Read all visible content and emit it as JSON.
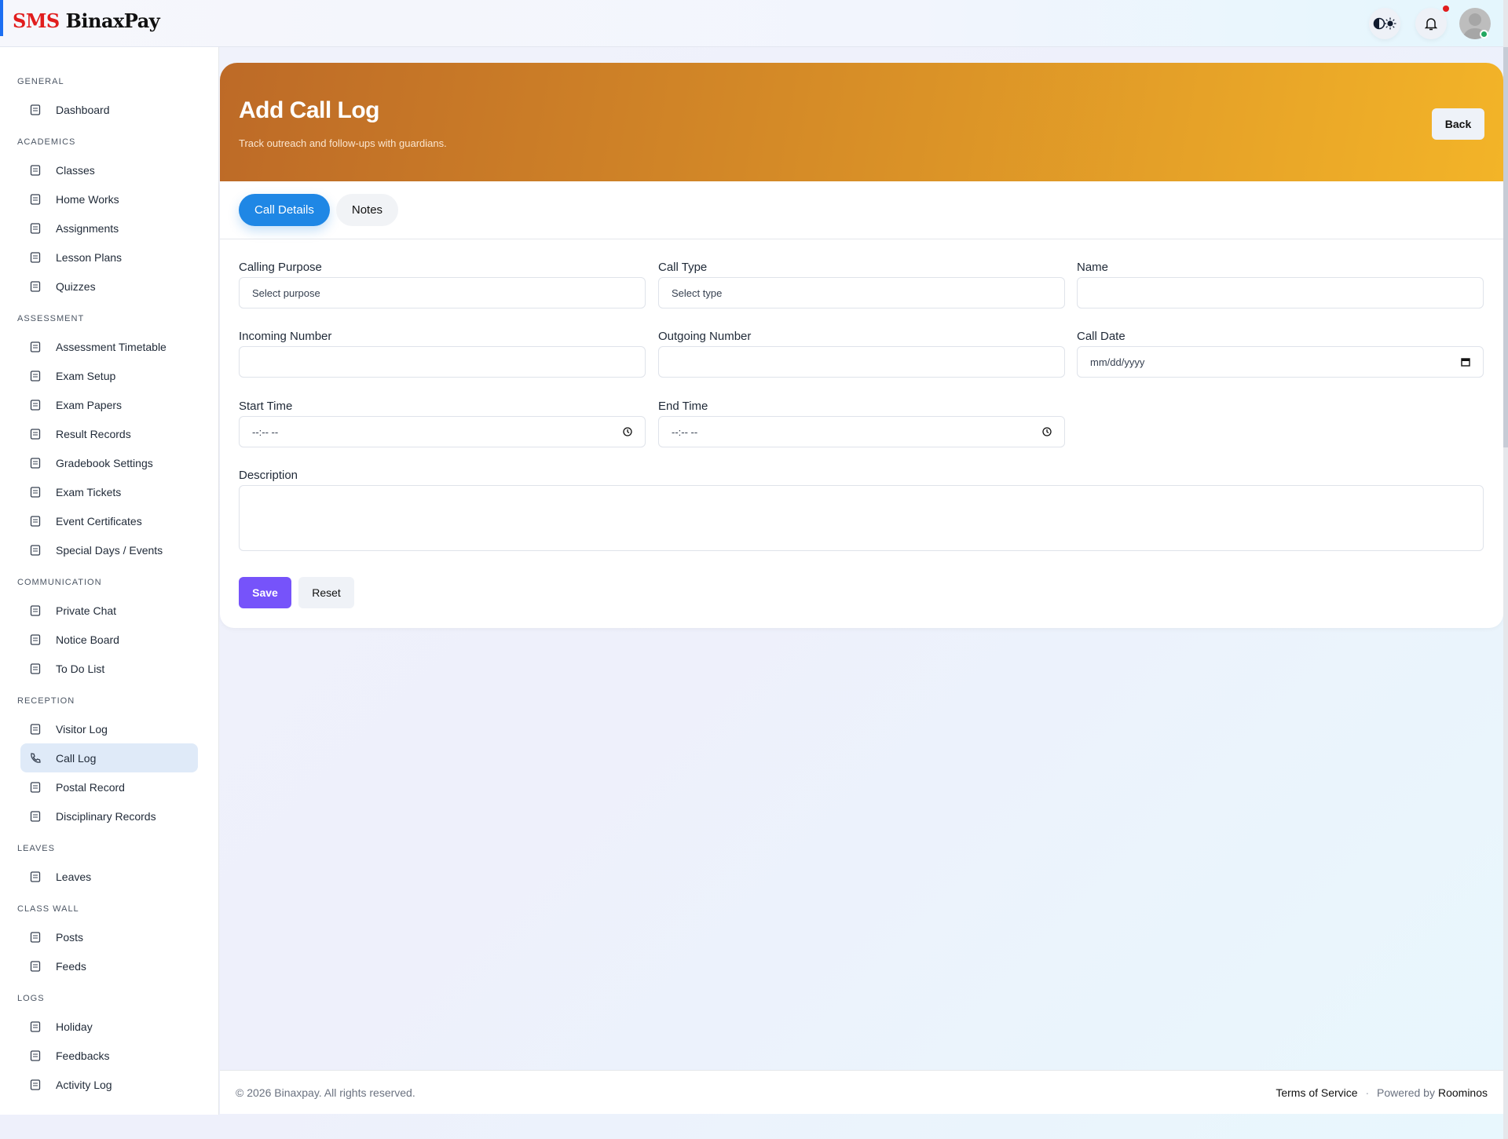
{
  "brand": {
    "sms": "SMS",
    "name": "BinaxPay"
  },
  "topbar": {
    "theme_icon": "contrast-sun-icon",
    "bell_icon": "bell-icon",
    "colors": {
      "notif": "#e11d1d",
      "online": "#22a861"
    }
  },
  "sidebar": {
    "sections": [
      {
        "title": "GENERAL",
        "items": [
          {
            "label": "Dashboard",
            "icon": "gauge-icon"
          }
        ]
      },
      {
        "title": "ACADEMICS",
        "items": [
          {
            "label": "Classes",
            "icon": "hierarchy-icon"
          },
          {
            "label": "Home Works",
            "icon": "notebook-icon"
          },
          {
            "label": "Assignments",
            "icon": "clipboard-check-icon"
          },
          {
            "label": "Lesson Plans",
            "icon": "book-icon"
          },
          {
            "label": "Quizzes",
            "icon": "award-icon"
          }
        ]
      },
      {
        "title": "ASSESSMENT",
        "items": [
          {
            "label": "Assessment Timetable",
            "icon": "table-icon"
          },
          {
            "label": "Exam Setup",
            "icon": "clipboard-plus-icon"
          },
          {
            "label": "Exam Papers",
            "icon": "grid-icon"
          },
          {
            "label": "Result Records",
            "icon": "check-square-icon"
          },
          {
            "label": "Gradebook Settings",
            "icon": "gear-icon"
          },
          {
            "label": "Exam Tickets",
            "icon": "ticket-icon"
          },
          {
            "label": "Event Certificates",
            "icon": "award-icon"
          },
          {
            "label": "Special Days / Events",
            "icon": "calendar-icon"
          }
        ]
      },
      {
        "title": "COMMUNICATION",
        "items": [
          {
            "label": "Private Chat",
            "icon": "chat-icon"
          },
          {
            "label": "Notice Board",
            "icon": "megaphone-icon"
          },
          {
            "label": "To Do List",
            "icon": "list-icon"
          }
        ]
      },
      {
        "title": "RECEPTION",
        "items": [
          {
            "label": "Visitor Log",
            "icon": "id-badge-icon"
          },
          {
            "label": "Call Log",
            "icon": "phone-icon",
            "active": true
          },
          {
            "label": "Postal Record",
            "icon": "mailbox-icon"
          },
          {
            "label": "Disciplinary Records",
            "icon": "warning-icon"
          }
        ]
      },
      {
        "title": "LEAVES",
        "items": [
          {
            "label": "Leaves",
            "icon": "clipboard-icon"
          }
        ]
      },
      {
        "title": "CLASS WALL",
        "items": [
          {
            "label": "Posts",
            "icon": "message-icon"
          },
          {
            "label": "Feeds",
            "icon": "rss-icon"
          }
        ]
      },
      {
        "title": "LOGS",
        "items": [
          {
            "label": "Holiday",
            "icon": "calendar-icon"
          },
          {
            "label": "Feedbacks",
            "icon": "message-icon"
          },
          {
            "label": "Activity Log",
            "icon": "activity-icon"
          }
        ]
      }
    ]
  },
  "hero": {
    "title": "Add Call Log",
    "subtitle": "Track outreach and follow-ups with guardians.",
    "back": "Back"
  },
  "tabs": [
    "Call Details",
    "Notes"
  ],
  "form": {
    "calling_purpose": {
      "label": "Calling Purpose",
      "value": "Select purpose"
    },
    "call_type": {
      "label": "Call Type",
      "value": "Select type"
    },
    "name": {
      "label": "Name",
      "value": ""
    },
    "incoming": {
      "label": "Incoming Number",
      "value": ""
    },
    "outgoing": {
      "label": "Outgoing Number",
      "value": ""
    },
    "call_date": {
      "label": "Call Date",
      "value": "mm/dd/yyyy"
    },
    "start_time": {
      "label": "Start Time",
      "value": "--:-- --"
    },
    "end_time": {
      "label": "End Time",
      "value": "--:-- --"
    },
    "description": {
      "label": "Description",
      "value": ""
    },
    "save": "Save",
    "reset": "Reset"
  },
  "footer": {
    "copyright": "© 2026 Binaxpay. All rights reserved.",
    "terms": "Terms of Service",
    "sep": "·",
    "powered": "Powered by",
    "company": "Roominos"
  }
}
